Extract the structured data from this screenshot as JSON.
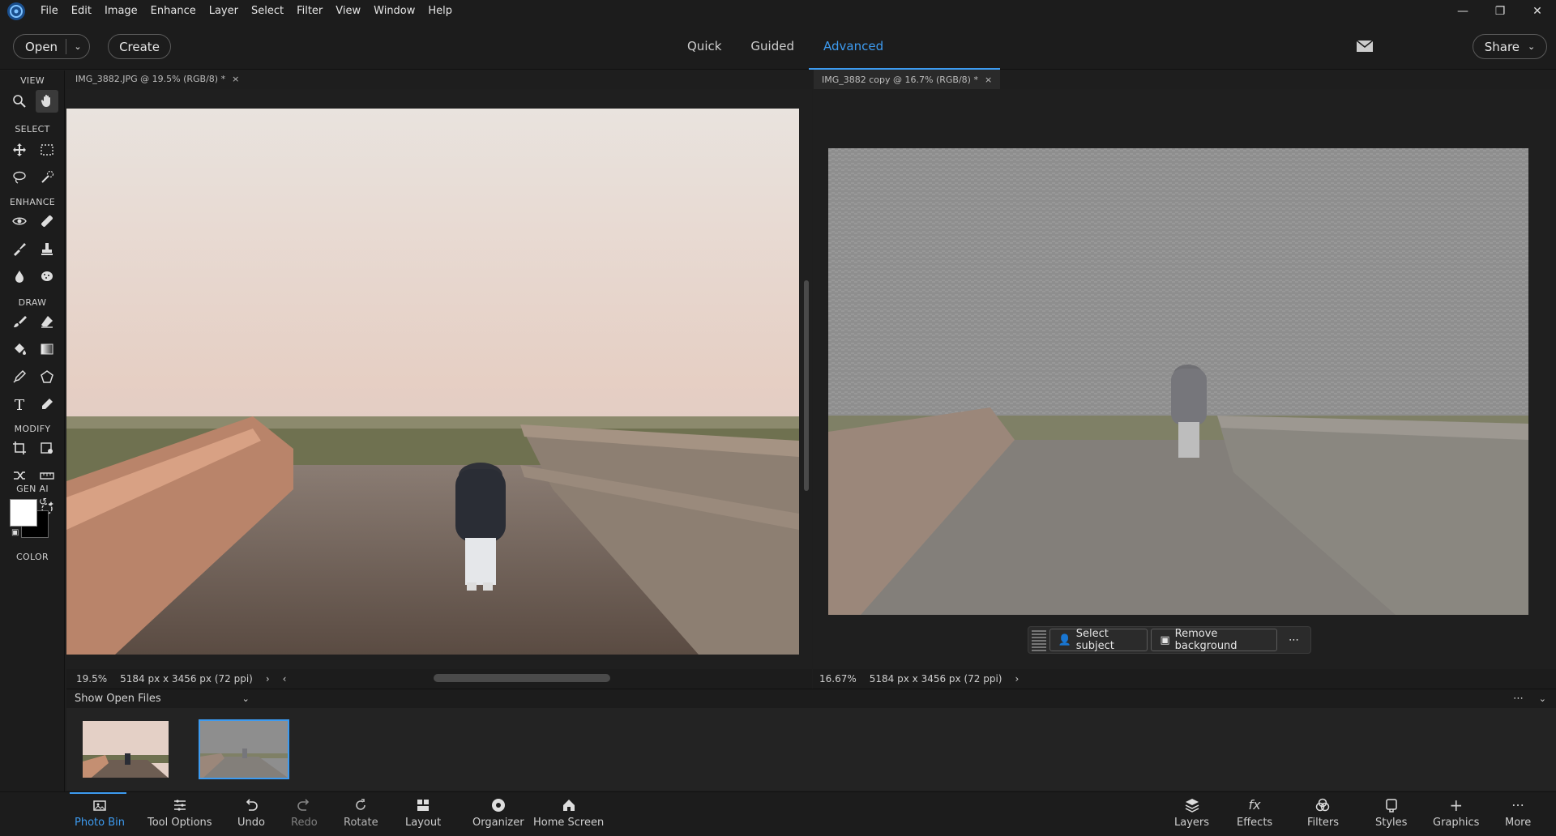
{
  "menu": {
    "items": [
      "File",
      "Edit",
      "Image",
      "Enhance",
      "Layer",
      "Select",
      "Filter",
      "View",
      "Window",
      "Help"
    ]
  },
  "toolbar": {
    "open_label": "Open",
    "create_label": "Create",
    "modes": [
      "Quick",
      "Guided",
      "Advanced"
    ],
    "active_mode": "Advanced",
    "share_label": "Share"
  },
  "tools": {
    "sections": [
      "VIEW",
      "SELECT",
      "ENHANCE",
      "DRAW",
      "MODIFY",
      "GEN AI",
      "COLOR"
    ]
  },
  "documents": [
    {
      "tab_title": "IMG_3882.JPG @ 19.5% (RGB/8) *",
      "zoom": "19.5%",
      "dimensions": "5184 px x 3456 px (72 ppi)"
    },
    {
      "tab_title": "IMG_3882 copy @ 16.7% (RGB/8) *",
      "zoom": "16.67%",
      "dimensions": "5184 px x 3456 px (72 ppi)"
    }
  ],
  "taskbar": {
    "select_subject": "Select subject",
    "remove_background": "Remove background"
  },
  "photo_bin": {
    "show_label": "Show Open Files"
  },
  "bottom": {
    "left": [
      "Photo Bin",
      "Tool Options",
      "Undo",
      "Redo",
      "Rotate",
      "Layout",
      "Organizer",
      "Home Screen"
    ],
    "right": [
      "Layers",
      "Effects",
      "Filters",
      "Styles",
      "Graphics",
      "More"
    ]
  },
  "colors": {
    "accent": "#3d9bf0",
    "foreground": "#ffffff",
    "background": "#000000"
  }
}
